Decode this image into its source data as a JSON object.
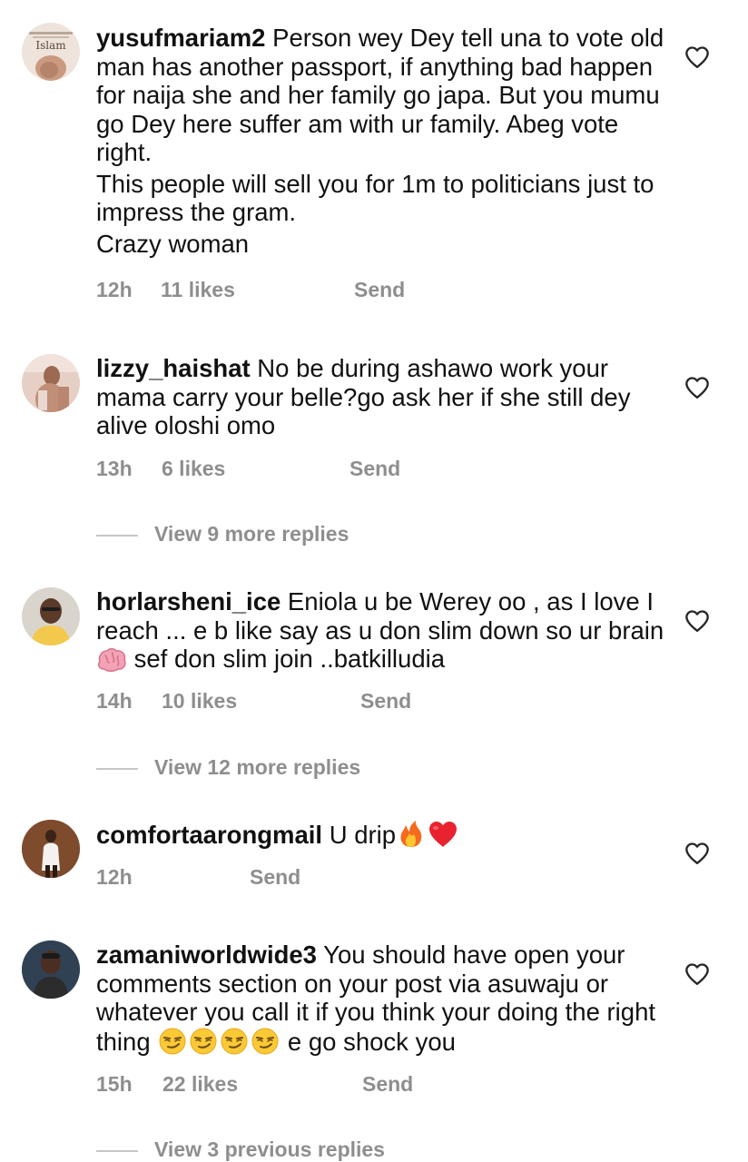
{
  "comments": [
    {
      "username": "yusufmariam2",
      "avatar_text": "Islam",
      "paragraphs": [
        " Person wey Dey tell una to vote old man has another passport, if anything bad happen for naija she and her family go japa. But you mumu go Dey here suffer am with ur family. Abeg vote right.",
        "This people will  sell you for 1m to politicians just to impress the gram.",
        "Crazy woman"
      ],
      "time": "12h",
      "likes": "11 likes",
      "send": "Send"
    },
    {
      "username": "lizzy_haishat",
      "text": " No be during ashawo work your mama carry your belle?go ask her if she still dey alive oloshi omo",
      "time": "13h",
      "likes": "6 likes",
      "send": "Send",
      "view_replies": "View 9 more replies"
    },
    {
      "username": "horlarsheni_ice",
      "text_a": " Eniola u be Werey oo , as I love I reach ... e b like say as u don slim down so ur brain ",
      "emoji_brain": "brain-emoji",
      "text_b": " sef don slim join ..batkilludia",
      "time": "14h",
      "likes": "10 likes",
      "send": "Send",
      "view_replies": "View 12 more replies"
    },
    {
      "username": "comfortaarongmail",
      "text": " U drip",
      "emojis": [
        "fire-emoji",
        "red-heart-emoji"
      ],
      "time": "12h",
      "send": "Send"
    },
    {
      "username": "zamaniworldwide3",
      "text_a": " You should have open your comments section on your post via asuwaju or whatever you call it if you think your doing the right thing ",
      "emojis": [
        "smirking-face-emoji",
        "smirking-face-emoji",
        "smirking-face-emoji",
        "smirking-face-emoji"
      ],
      "text_b": " e go shock you",
      "time": "15h",
      "likes": "22 likes",
      "send": "Send",
      "view_replies": "View 3 previous replies"
    }
  ],
  "colors": {
    "text": "#111111",
    "meta": "#8e8e8e",
    "divider": "#c7c7c7"
  },
  "icons": {
    "like": "heart-outline-icon"
  }
}
